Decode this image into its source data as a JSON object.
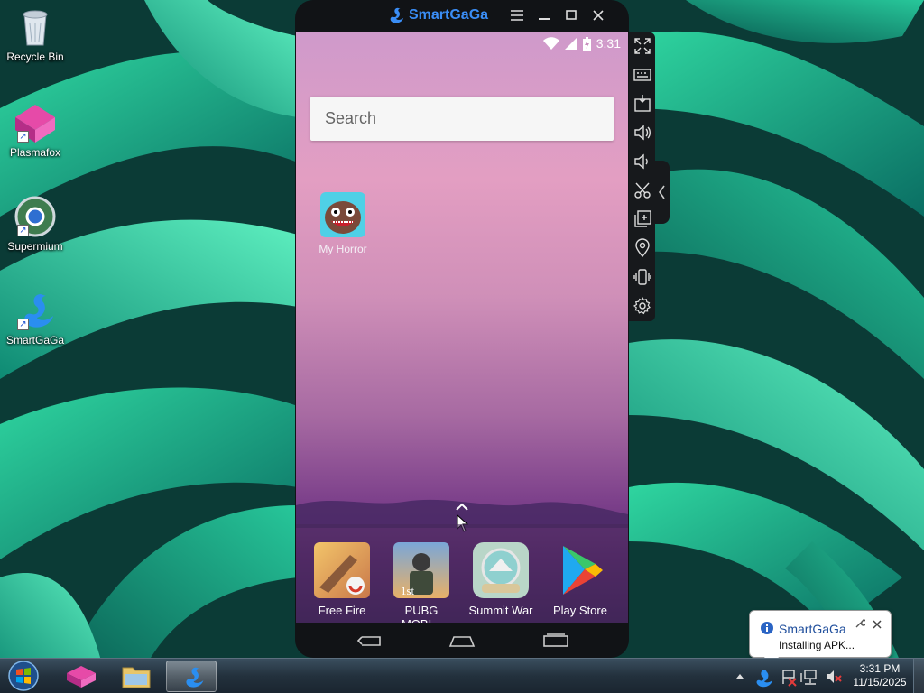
{
  "desktop": {
    "icons": [
      {
        "label": "Recycle Bin",
        "icon": "recycle-bin-icon"
      },
      {
        "label": "Plasmafox",
        "icon": "plasmafox-icon"
      },
      {
        "label": "Supermium",
        "icon": "supermium-icon"
      },
      {
        "label": "SmartGaGa",
        "icon": "smartgaga-icon"
      }
    ]
  },
  "emulator": {
    "brand": "SmartGaGa",
    "status": {
      "time": "3:31"
    },
    "search": {
      "placeholder": "Search"
    },
    "home_apps": [
      {
        "label": "My Horror"
      }
    ],
    "dock_apps": [
      {
        "label": "Free Fire"
      },
      {
        "label": "PUBG MOBI..."
      },
      {
        "label": "Summit War"
      },
      {
        "label": "Play Store"
      }
    ]
  },
  "notification": {
    "title": "SmartGaGa",
    "message": "Installing APK..."
  },
  "taskbar": {
    "clock_time": "3:31 PM",
    "clock_date": "11/15/2025"
  },
  "colors": {
    "brand_blue": "#3a8df5",
    "emulator_frame": "#111316",
    "taskbar": "#23313d"
  }
}
